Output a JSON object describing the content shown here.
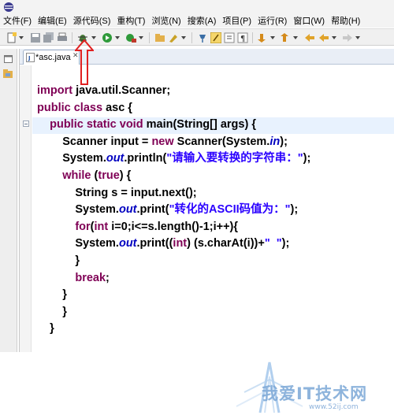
{
  "menubar": {
    "items": [
      "文件(F)",
      "编辑(E)",
      "源代码(S)",
      "重构(T)",
      "浏览(N)",
      "搜索(A)",
      "项目(P)",
      "运行(R)",
      "窗口(W)",
      "帮助(H)"
    ]
  },
  "editor": {
    "tab_label": "*asc.java",
    "tab_close": "✕",
    "code_lines": [
      [
        {
          "t": "import ",
          "c": "kw"
        },
        {
          "t": "java.util.Scanner;",
          "c": ""
        }
      ],
      [
        {
          "t": "public ",
          "c": "kw"
        },
        {
          "t": "class ",
          "c": "kw"
        },
        {
          "t": "asc {",
          "c": ""
        }
      ],
      [
        {
          "t": "    public ",
          "c": "kw"
        },
        {
          "t": "static ",
          "c": "kw"
        },
        {
          "t": "void ",
          "c": "kw"
        },
        {
          "t": "main(String[] args) {",
          "c": ""
        }
      ],
      [
        {
          "t": "        Scanner input = ",
          "c": ""
        },
        {
          "t": "new ",
          "c": "kw"
        },
        {
          "t": "Scanner(System.",
          "c": ""
        },
        {
          "t": "in",
          "c": "fld"
        },
        {
          "t": ");",
          "c": ""
        }
      ],
      [
        {
          "t": "        System.",
          "c": ""
        },
        {
          "t": "out",
          "c": "fld"
        },
        {
          "t": ".println(",
          "c": ""
        },
        {
          "t": "\"请输入要转换的字符串：\"",
          "c": "str"
        },
        {
          "t": ");",
          "c": ""
        }
      ],
      [
        {
          "t": "        while ",
          "c": "kw"
        },
        {
          "t": "(",
          "c": ""
        },
        {
          "t": "true",
          "c": "kw"
        },
        {
          "t": ") {",
          "c": ""
        }
      ],
      [
        {
          "t": "            String s = input.next();",
          "c": ""
        }
      ],
      [
        {
          "t": "            System.",
          "c": ""
        },
        {
          "t": "out",
          "c": "fld"
        },
        {
          "t": ".print(",
          "c": ""
        },
        {
          "t": "\"转化的ASCII码值为：\"",
          "c": "str"
        },
        {
          "t": ");",
          "c": ""
        }
      ],
      [
        {
          "t": "            for",
          "c": "kw"
        },
        {
          "t": "(",
          "c": ""
        },
        {
          "t": "int ",
          "c": "kw"
        },
        {
          "t": "i=0;i<=s.length()-1;i++){",
          "c": ""
        }
      ],
      [
        {
          "t": "            System.",
          "c": ""
        },
        {
          "t": "out",
          "c": "fld"
        },
        {
          "t": ".print((",
          "c": ""
        },
        {
          "t": "int",
          "c": "kw"
        },
        {
          "t": ") (s.charAt(i))+",
          "c": ""
        },
        {
          "t": "\"  \"",
          "c": "str"
        },
        {
          "t": ");",
          "c": ""
        }
      ],
      [
        {
          "t": "            }",
          "c": ""
        }
      ],
      [
        {
          "t": "            break",
          "c": "kw"
        },
        {
          "t": ";",
          "c": ""
        }
      ],
      [
        {
          "t": "        }",
          "c": ""
        }
      ],
      [
        {
          "t": "        }",
          "c": ""
        }
      ],
      [
        {
          "t": "    }",
          "c": ""
        }
      ]
    ]
  },
  "watermark": {
    "text": "我爱IT技术网",
    "url": "www.52ij.com"
  },
  "colors": {
    "keyword": "#7f0055",
    "string": "#2a00ff",
    "field": "#0000c0",
    "highlight": "#e8f2fe",
    "arrow": "#e02020"
  }
}
